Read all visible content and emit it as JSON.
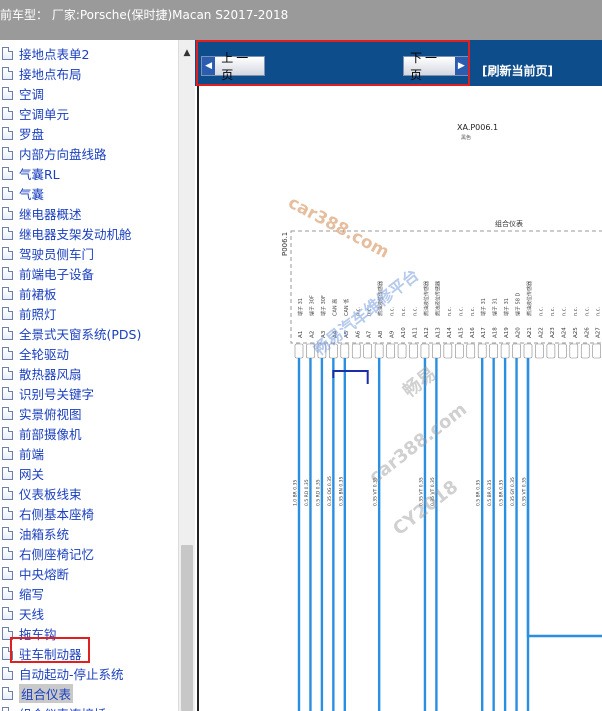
{
  "header": {
    "title": "前车型：  厂家:Porsche(保时捷)Macan S2017-2018"
  },
  "sidebar": {
    "items": [
      {
        "label": "接地点表单2"
      },
      {
        "label": "接地点布局"
      },
      {
        "label": "空调"
      },
      {
        "label": "空调单元"
      },
      {
        "label": "罗盘"
      },
      {
        "label": "内部方向盘线路"
      },
      {
        "label": "气囊RL"
      },
      {
        "label": "气囊"
      },
      {
        "label": "继电器概述"
      },
      {
        "label": "继电器支架发动机舱"
      },
      {
        "label": "驾驶员侧车门"
      },
      {
        "label": "前端电子设备"
      },
      {
        "label": "前裙板"
      },
      {
        "label": "前照灯"
      },
      {
        "label": "全景式天窗系统(PDS)"
      },
      {
        "label": "全轮驱动"
      },
      {
        "label": "散热器风扇"
      },
      {
        "label": "识别号关键字"
      },
      {
        "label": "实景俯视图"
      },
      {
        "label": "前部摄像机"
      },
      {
        "label": "前端"
      },
      {
        "label": "网关"
      },
      {
        "label": "仪表板线束"
      },
      {
        "label": "右侧基本座椅"
      },
      {
        "label": "油箱系统"
      },
      {
        "label": "右侧座椅记忆"
      },
      {
        "label": "中央熔断"
      },
      {
        "label": "缩写"
      },
      {
        "label": "天线"
      },
      {
        "label": "拖车钩"
      },
      {
        "label": "驻车制动器"
      },
      {
        "label": "自动起动-停止系统"
      },
      {
        "label": "组合仪表",
        "selected": true
      },
      {
        "label": "组合仪表连接插"
      }
    ]
  },
  "nav": {
    "prev_label": "上一页",
    "next_label": "下一页",
    "refresh_label": "[刷新当前页]"
  },
  "diagram": {
    "connector_label": "XA.P006.1",
    "connector_sub": "黑色",
    "component_label": "组合仪表",
    "side_label": "P006.1",
    "pins": [
      "A1",
      "A2",
      "A3",
      "A4",
      "A5",
      "A6",
      "A7",
      "A8",
      "A9",
      "A10",
      "A11",
      "A12",
      "A13",
      "A14",
      "A15",
      "A16",
      "A17",
      "A18",
      "A19",
      "A20",
      "A21",
      "A22",
      "A23",
      "A24",
      "A25",
      "A26",
      "A27"
    ],
    "pin_functions": [
      "端子 31",
      "端子 30F",
      "端子 30F",
      "CAN 高",
      "CAN 低",
      "n.c.",
      "n.c.",
      "燃油液位传感器",
      "n.c.",
      "n.c.",
      "n.c.",
      "燃油液位传感器",
      "燃油液位传感器",
      "n.c.",
      "n.c.",
      "n.c.",
      "端子 31",
      "端子 31",
      "端子 31",
      "端子 58 D",
      "燃油液位传感器",
      "n.c.",
      "n.c.",
      "n.c.",
      "n.c.",
      "n.c.",
      "n.c."
    ],
    "wire_codes": [
      "1.0 BR 0.35",
      "0.5 RD 0.35",
      "0.5 RD 0.35",
      "0.35 OG 0.35",
      "0.35 BN 0.35",
      "",
      "",
      "0.35 VT 0.35",
      "",
      "",
      "",
      "0.35 VT 0.35",
      "0.35 VT 0.35",
      "",
      "",
      "",
      "0.5 BR 0.35",
      "0.5 BR 0.35",
      "0.5 BR 0.35",
      "0.35 GY 0.35",
      "0.35 VT 0.35",
      "",
      "",
      "",
      "",
      "",
      ""
    ],
    "watermarks": [
      "car388.com",
      "畅易汽车维修平台",
      "畅易",
      "car388.com",
      "CY2018"
    ]
  }
}
